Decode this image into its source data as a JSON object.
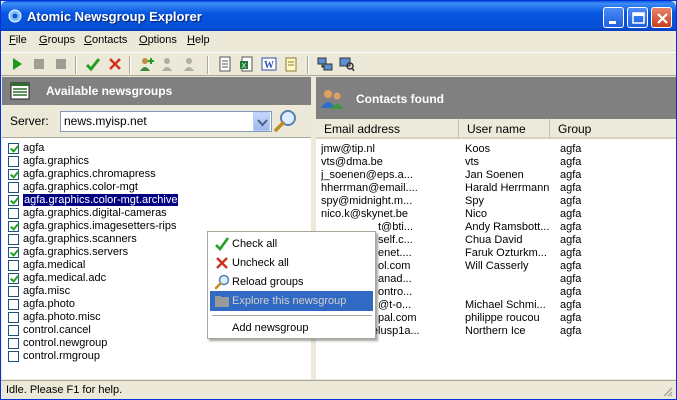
{
  "window": {
    "title": "Atomic Newsgroup Explorer"
  },
  "menu": [
    {
      "label": "File",
      "accel": "F",
      "rest": "ile"
    },
    {
      "label": "Groups",
      "accel": "G",
      "rest": "roups"
    },
    {
      "label": "Contacts",
      "accel": "C",
      "rest": "ontacts"
    },
    {
      "label": "Options",
      "accel": "O",
      "rest": "ptions"
    },
    {
      "label": "Help",
      "accel": "H",
      "rest": "elp"
    }
  ],
  "left_panel": {
    "title": "Available newsgroups",
    "server_label": "Server:",
    "server_value": "news.myisp.net"
  },
  "groups": [
    {
      "name": "agfa",
      "checked": true
    },
    {
      "name": "agfa.graphics",
      "checked": false
    },
    {
      "name": "agfa.graphics.chromapress",
      "checked": true
    },
    {
      "name": "agfa.graphics.color-mgt",
      "checked": false
    },
    {
      "name": "agfa.graphics.color-mgt.archive",
      "checked": true,
      "selected": true
    },
    {
      "name": "agfa.graphics.digital-cameras",
      "checked": false
    },
    {
      "name": "agfa.graphics.imagesetters-rips",
      "checked": true
    },
    {
      "name": "agfa.graphics.scanners",
      "checked": false
    },
    {
      "name": "agfa.graphics.servers",
      "checked": true
    },
    {
      "name": "agfa.medical",
      "checked": false
    },
    {
      "name": "agfa.medical.adc",
      "checked": true
    },
    {
      "name": "agfa.misc",
      "checked": false
    },
    {
      "name": "agfa.photo",
      "checked": false
    },
    {
      "name": "agfa.photo.misc",
      "checked": false
    },
    {
      "name": "control.cancel",
      "checked": false
    },
    {
      "name": "control.newgroup",
      "checked": false
    },
    {
      "name": "control.rmgroup",
      "checked": false
    }
  ],
  "right_panel": {
    "title": "Contacts found",
    "columns": [
      "Email address",
      "User name",
      "Group"
    ]
  },
  "contacts": [
    {
      "email": "jmw@tip.nl",
      "name": "Koos",
      "group": "agfa"
    },
    {
      "email": "vts@dma.be",
      "name": "vts",
      "group": "agfa"
    },
    {
      "email": "j_soenen@eps.a...",
      "name": "Jan Soenen",
      "group": "agfa"
    },
    {
      "email": "hherrman@email....",
      "name": "Harald Herrmann",
      "group": "agfa"
    },
    {
      "email": "spy@midnight.m...",
      "name": "Spy",
      "group": "agfa"
    },
    {
      "email": "nico.k@skynet.be",
      "name": "Nico",
      "group": "agfa"
    },
    {
      "email": "t@bti...",
      "name": "Andy Ramsbott...",
      "group": "agfa"
    },
    {
      "email": "self.c...",
      "name": "Chua David",
      "group": "agfa"
    },
    {
      "email": "enet....",
      "name": "Faruk Ozturkm...",
      "group": "agfa"
    },
    {
      "email": "ol.com",
      "name": "Will Casserly",
      "group": "agfa"
    },
    {
      "email": "anad...",
      "name": "",
      "group": "agfa"
    },
    {
      "email": "ontro...",
      "name": "",
      "group": "agfa"
    },
    {
      "email": "@t-o...",
      "name": "Michael Schmi...",
      "group": "agfa"
    },
    {
      "email": "pal.com",
      "name": "philippe roucou",
      "group": "agfa"
    },
    {
      "email": "petersn@telusp1a...",
      "name": "Northern Ice",
      "group": "agfa"
    }
  ],
  "context_menu": [
    {
      "label": "Check all",
      "icon": "check-icon",
      "enabled": true
    },
    {
      "label": "Uncheck all",
      "icon": "x-icon",
      "enabled": true
    },
    {
      "label": "Reload groups",
      "icon": "magnifier-icon",
      "enabled": true
    },
    {
      "label": "Explore this newsgroup",
      "icon": "folder-icon",
      "enabled": false,
      "highlighted": true
    },
    {
      "label": "Add newsgroup",
      "icon": "",
      "enabled": true
    }
  ],
  "status": {
    "text": "Idle. Please F1 for help."
  }
}
